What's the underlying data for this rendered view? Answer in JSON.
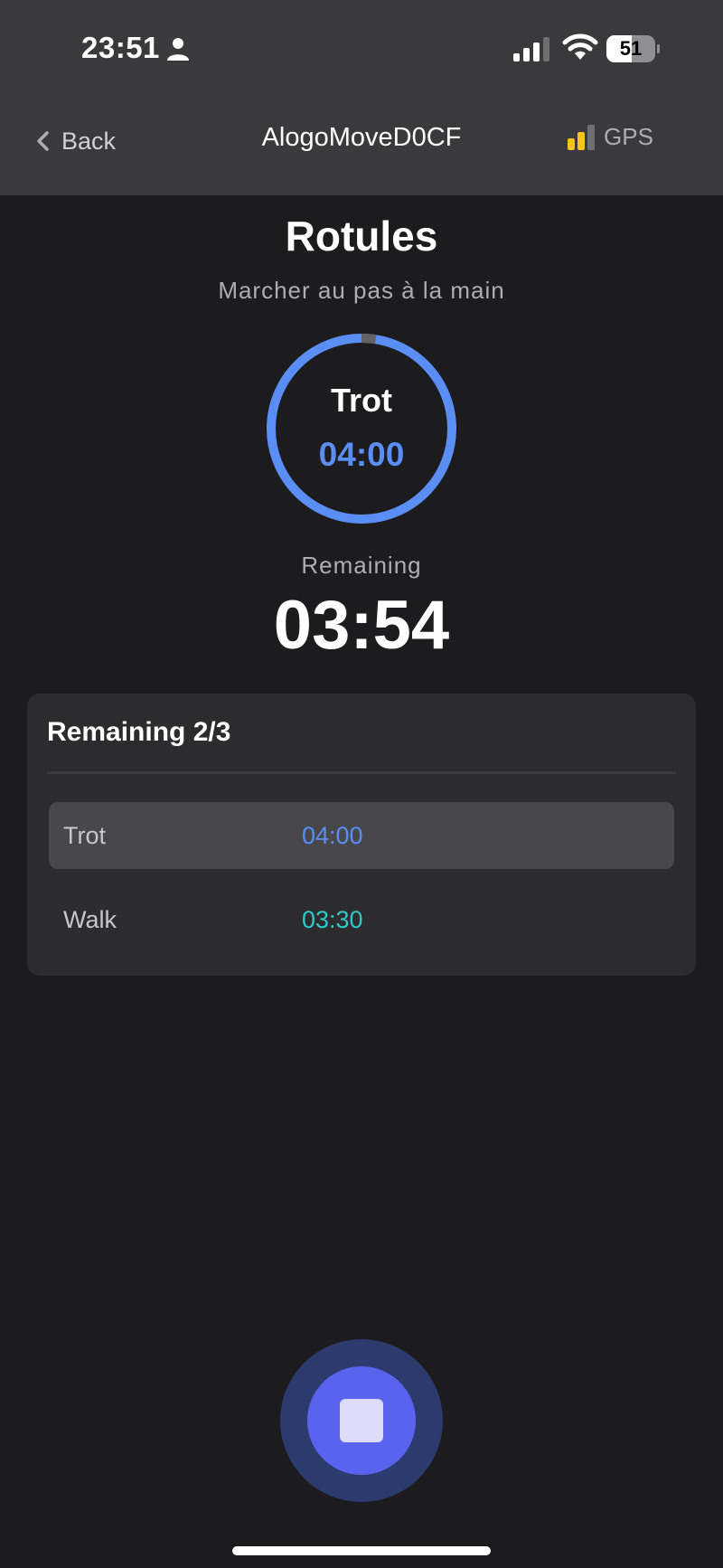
{
  "status_bar": {
    "time": "23:51",
    "battery": "51",
    "battery_level": 0.51
  },
  "nav": {
    "back_label": "Back",
    "title": "AlogoMoveD0CF",
    "gps_label": "GPS"
  },
  "exercise": {
    "title": "Rotules",
    "subtitle": "Marcher au pas à la main"
  },
  "current_step": {
    "label": "Trot",
    "time": "04:00",
    "progress": 0.025
  },
  "remaining": {
    "label": "Remaining",
    "value": "03:54"
  },
  "steps_card": {
    "title": "Remaining 2/3",
    "rows": [
      {
        "name": "Trot",
        "time": "04:00",
        "color": "#5b8ef5",
        "active": true
      },
      {
        "name": "Walk",
        "time": "03:30",
        "color": "#30c8c8",
        "active": false
      }
    ]
  },
  "colors": {
    "accent": "#5b8ef5",
    "walk": "#30c8c8",
    "gps_signal": "#f5c518",
    "stop_button": "#5a63ef"
  },
  "icons": {
    "person": "person-icon",
    "signal": "cellular-signal-icon",
    "wifi": "wifi-icon",
    "back": "chevron-left-icon",
    "gps": "gps-signal-icon",
    "stop": "stop-icon"
  }
}
